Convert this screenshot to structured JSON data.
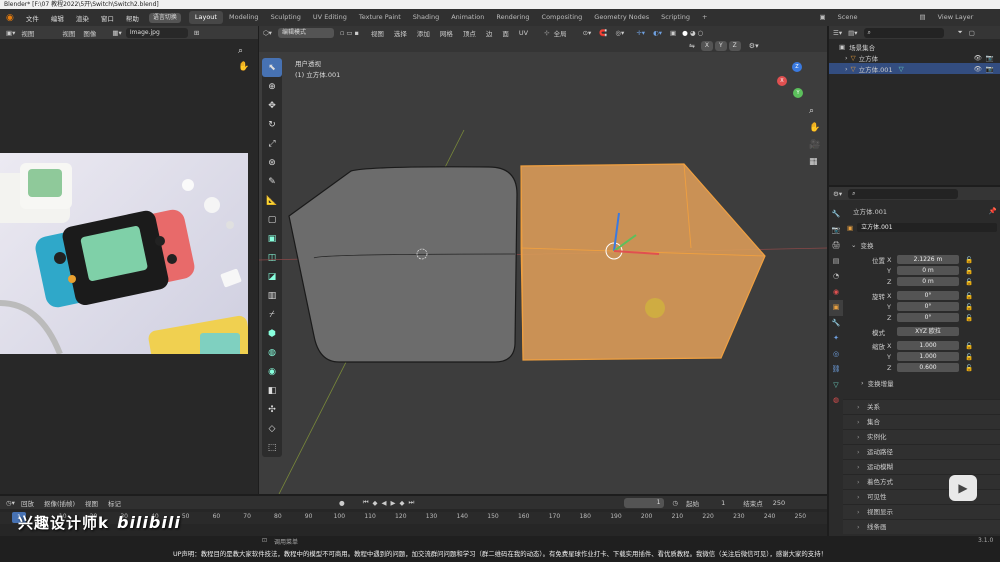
{
  "titlebar": {
    "title": "Blender* [F:\\07 教程2022\\5开\\Switch\\Switch2.blend]"
  },
  "menu": {
    "items": [
      "文件",
      "编辑",
      "渲染",
      "窗口",
      "帮助"
    ],
    "lang_btn": "语言切换"
  },
  "workspaces": [
    "Layout",
    "Modeling",
    "Sculpting",
    "UV Editing",
    "Texture Paint",
    "Shading",
    "Animation",
    "Rendering",
    "Compositing",
    "Geometry Nodes",
    "Scripting"
  ],
  "scene": {
    "label": "Scene",
    "view_layer": "View Layer"
  },
  "image_editor": {
    "menu": [
      "视图",
      "视图",
      "图像"
    ],
    "image_name": "Image.jpg"
  },
  "viewport": {
    "mode": "编辑模式",
    "menu": [
      "视图",
      "选择",
      "添加",
      "网格",
      "顶点",
      "边",
      "面",
      "UV"
    ],
    "transform": "全局",
    "axes": [
      "X",
      "Y",
      "Z"
    ],
    "view_name": "用户透视",
    "object_name": "(1) 立方体.001"
  },
  "outliner": {
    "scene_collection": "场景集合",
    "items": [
      {
        "name": "立方体"
      },
      {
        "name": "立方体.001"
      }
    ]
  },
  "properties": {
    "object_name": "立方体.001",
    "data_name": "立方体.001",
    "transform_title": "变换",
    "location": {
      "label": "位置",
      "x": "2.1226 m",
      "y": "0 m",
      "z": "0 m"
    },
    "rotation": {
      "label": "旋转",
      "x": "0°",
      "y": "0°",
      "z": "0°"
    },
    "mode": {
      "label": "模式",
      "value": "XYZ 欧拉"
    },
    "scale": {
      "label": "缩放",
      "x": "1.000",
      "y": "1.000",
      "z": "0.600"
    },
    "delta": "变换增量",
    "axis_x": "X",
    "axis_y": "Y",
    "axis_z": "Z",
    "panels": [
      "关系",
      "集合",
      "实例化",
      "运动路径",
      "运动模糊",
      "着色方式",
      "可见性",
      "视图显示",
      "线条画"
    ]
  },
  "timeline": {
    "menu": [
      "回放",
      "抠像(插帧)",
      "视图",
      "标记"
    ],
    "current_frame": "1",
    "start_label": "起始",
    "start": "1",
    "end_label": "结束点",
    "end": "250",
    "ticks": [
      "10",
      "20",
      "30",
      "40",
      "50",
      "60",
      "70",
      "80",
      "90",
      "100",
      "110",
      "120",
      "130",
      "140",
      "150",
      "160",
      "170",
      "180",
      "190",
      "200",
      "210",
      "220",
      "230",
      "240",
      "250"
    ],
    "tick_values": [
      10,
      20,
      30,
      40,
      50,
      60,
      70,
      80,
      90,
      100,
      110,
      120,
      130,
      140,
      150,
      160,
      170,
      180,
      190,
      200,
      210,
      220,
      230,
      240,
      250
    ]
  },
  "status": {
    "hint": "调用菜单",
    "notice": "UP声明：教程目的是教大家软件技法，教程中的模型不可商用。教程中遇到的问题，加交流群问问题和学习（群二维码在我的动态）。有免费星球作业打卡、下载实用插件、看优质教程。我微信（关注后微信可见），感谢大家的支持！",
    "version": "3.1.0"
  },
  "watermark": {
    "text": "兴趣设计师k"
  }
}
